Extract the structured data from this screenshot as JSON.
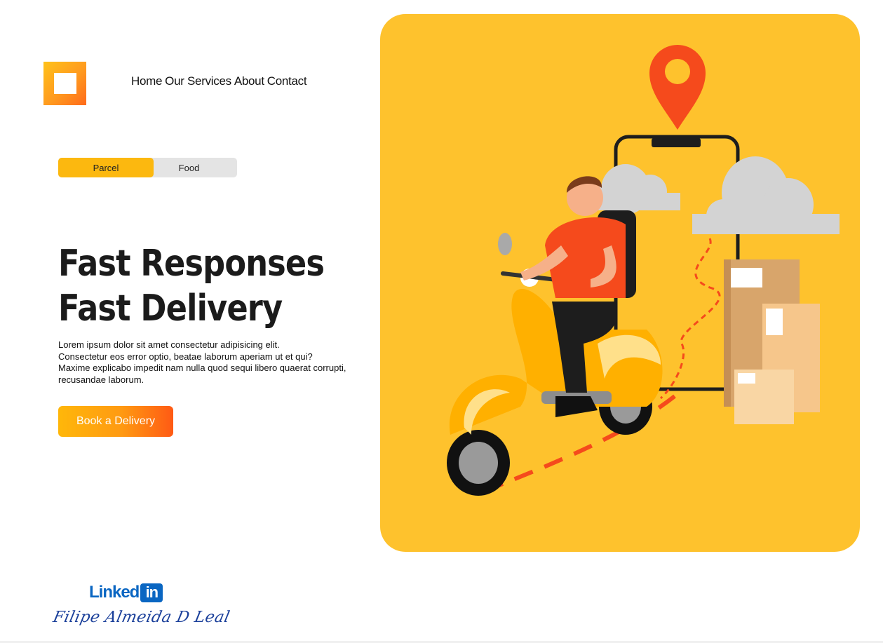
{
  "nav": {
    "items": [
      "Home",
      "Our Services",
      "About",
      "Contact"
    ]
  },
  "tabs": {
    "items": [
      "Parcel",
      "Food"
    ],
    "active": "Parcel"
  },
  "hero": {
    "headline_line1": "Fast Responses",
    "headline_line2": "Fast Delivery",
    "description_lines": [
      "Lorem ipsum dolor sit amet consectetur adipisicing elit.",
      "Consectetur eos error optio, beatae laborum aperiam ut et qui?",
      "Maxime explicabo impedit nam nulla quod sequi libero quaerat corrupti,",
      "recusandae laborum."
    ],
    "cta_label": "Book a Delivery"
  },
  "footer": {
    "linkedin_text": "Linked",
    "linkedin_badge": "in",
    "signature": "Filipe Almeida D Leal"
  },
  "colors": {
    "accent": "#fcb80f",
    "hero_bg": "#fec22d",
    "orange": "#ff5a14",
    "linkedin": "#0a66c2"
  },
  "icons": [
    "logo-square-icon",
    "location-pin-icon",
    "linkedin-icon"
  ]
}
